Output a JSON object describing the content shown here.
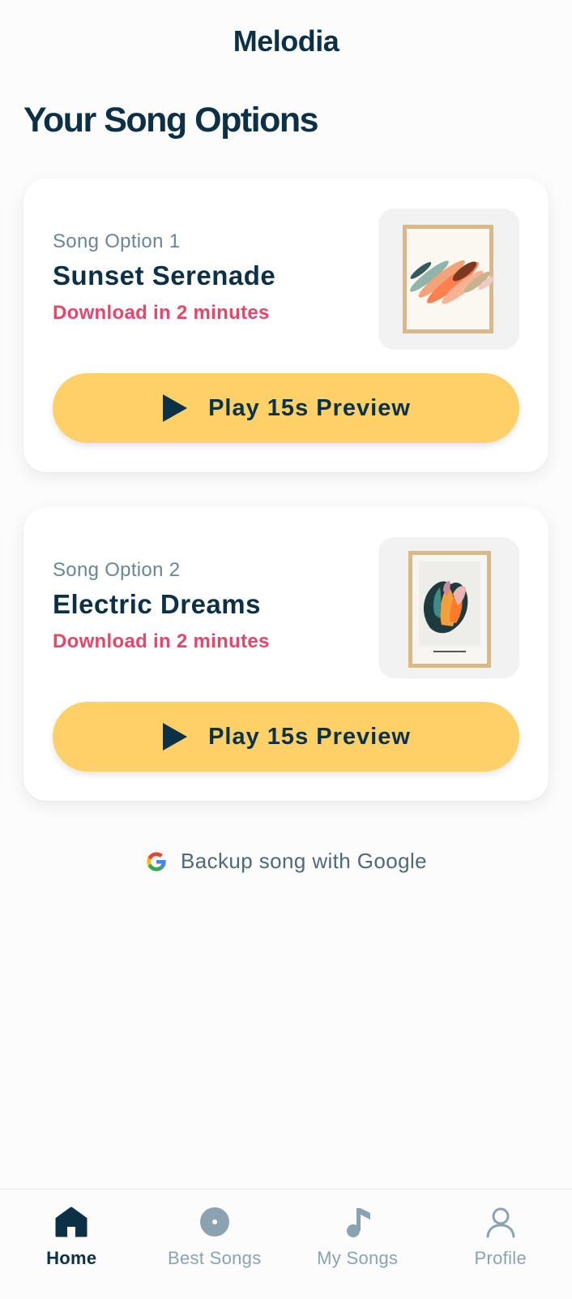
{
  "header": {
    "app_title": "Melodia"
  },
  "page": {
    "heading": "Your Song Options"
  },
  "songs": [
    {
      "option_label": "Song Option 1",
      "title": "Sunset Serenade",
      "download_text": "Download in 2 minutes",
      "play_label": "Play 15s Preview"
    },
    {
      "option_label": "Song Option 2",
      "title": "Electric Dreams",
      "download_text": "Download in 2 minutes",
      "play_label": "Play 15s Preview"
    }
  ],
  "backup": {
    "label": "Backup song with Google",
    "icon": "google-icon"
  },
  "nav": {
    "items": [
      {
        "label": "Home",
        "icon": "home-icon",
        "active": true
      },
      {
        "label": "Best Songs",
        "icon": "disc-icon",
        "active": false
      },
      {
        "label": "My Songs",
        "icon": "music-note-icon",
        "active": false
      },
      {
        "label": "Profile",
        "icon": "user-icon",
        "active": false
      }
    ]
  },
  "colors": {
    "primary_text": "#0c3146",
    "accent_yellow": "#fed168",
    "download_red": "#e8456a",
    "muted_text": "#6a8796"
  }
}
